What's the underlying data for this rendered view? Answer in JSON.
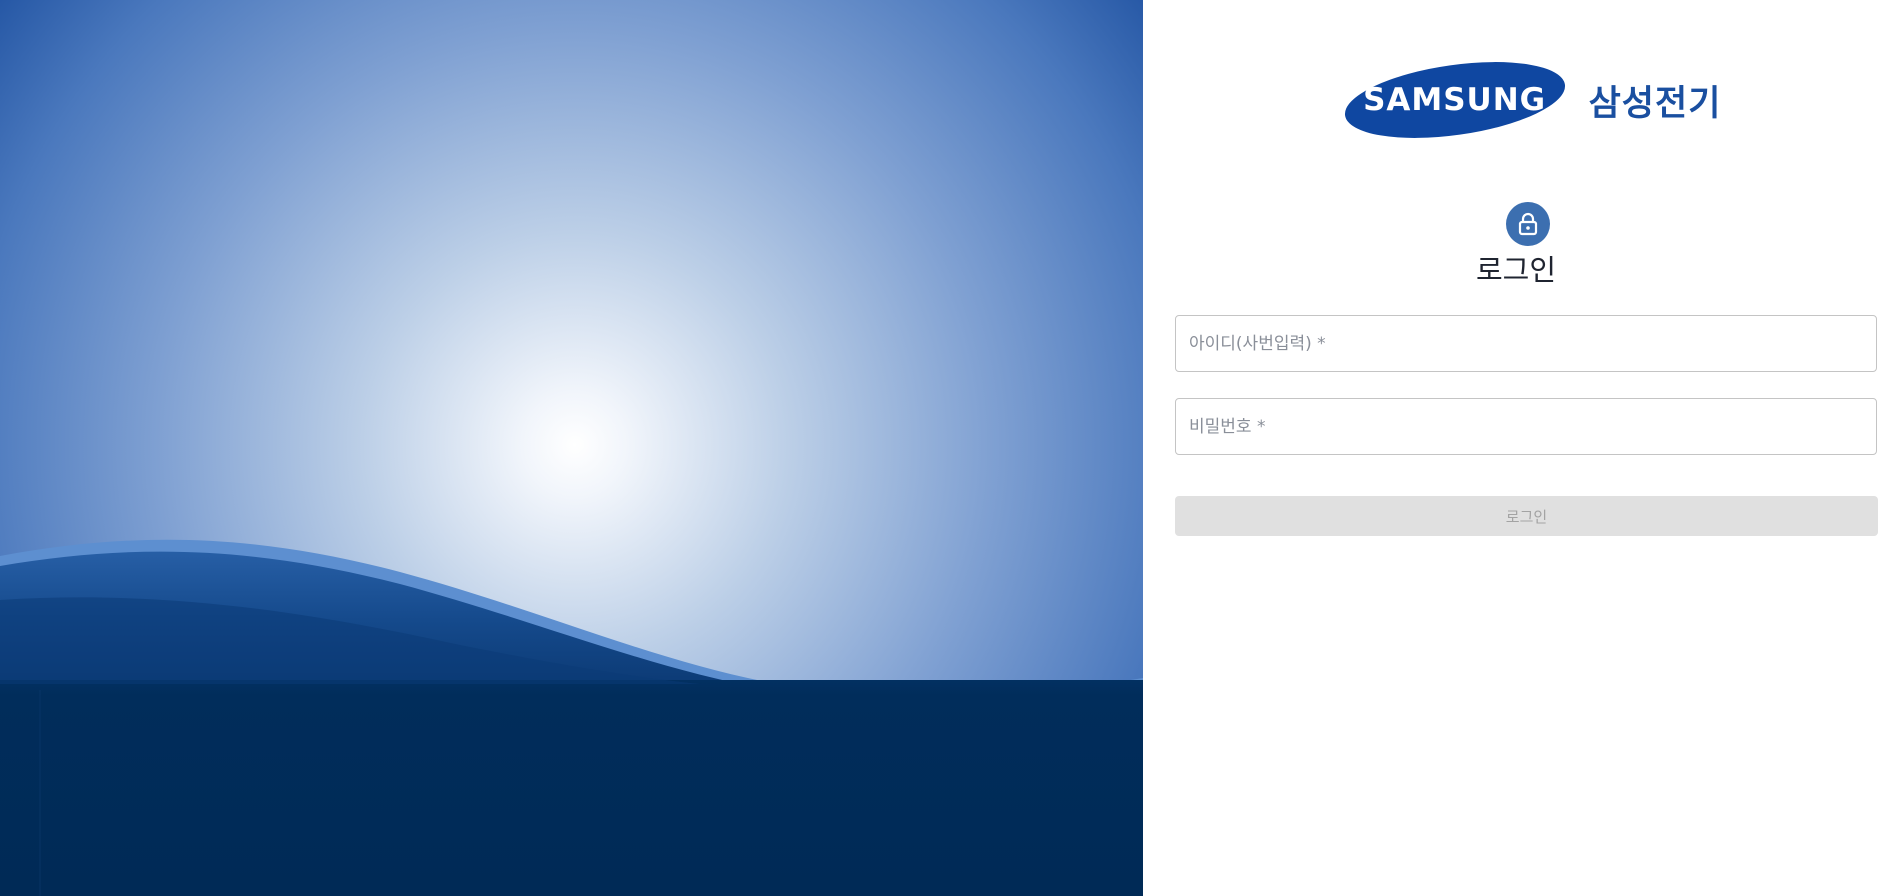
{
  "brand": {
    "logo_text": "SAMSUNG",
    "company_name": "삼성전기",
    "logo_color": "#0f47a1"
  },
  "login": {
    "lock_icon": "lock-icon",
    "title": "로그인",
    "id_placeholder": "아이디(사번입력) *",
    "id_value": "",
    "password_placeholder": "비밀번호 *",
    "password_value": "",
    "submit_label": "로그인",
    "submit_disabled": true
  },
  "theme": {
    "accent": "#3c6fb0",
    "hero_dark": "#002c5a",
    "hero_light": "#ffffff",
    "button_disabled_bg": "#e0e0e0"
  }
}
